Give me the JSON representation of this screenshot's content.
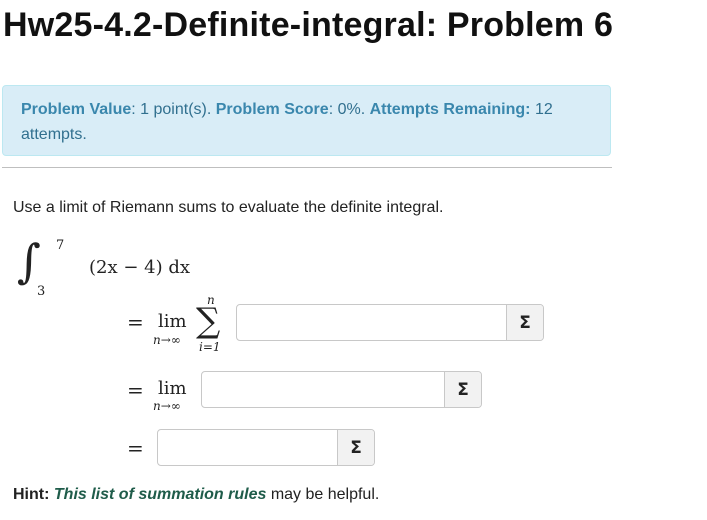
{
  "title": "Hw25-4.2-Definite-integral: Problem 6",
  "info": {
    "value_key": "Problem Value",
    "value_text": ": 1 point(s). ",
    "score_key": "Problem Score",
    "score_text": ": 0%. ",
    "attempts_key": "Attempts Remaining:",
    "attempts_text": " 12 attempts."
  },
  "prompt": "Use a limit of Riemann sums to evaluate the definite integral.",
  "integral": {
    "upper": "7",
    "lower": "3",
    "integrand": "(2x − 4) dx"
  },
  "rows": {
    "eq": "=",
    "lim": "lim",
    "lim_sub": "n→∞",
    "sum_top": "n",
    "sum_bottom": "i=1",
    "sigma": "∑"
  },
  "answer_fields": [
    {
      "value": "",
      "button": "Σ"
    },
    {
      "value": "",
      "button": "Σ"
    },
    {
      "value": "",
      "button": "Σ"
    }
  ],
  "hint": {
    "label": "Hint:",
    "link": "This list of summation rules",
    "rest": " may be helpful."
  },
  "colors": {
    "info_bg": "#d9edf7",
    "info_text": "#31708f",
    "link": "#1f5c4a"
  }
}
